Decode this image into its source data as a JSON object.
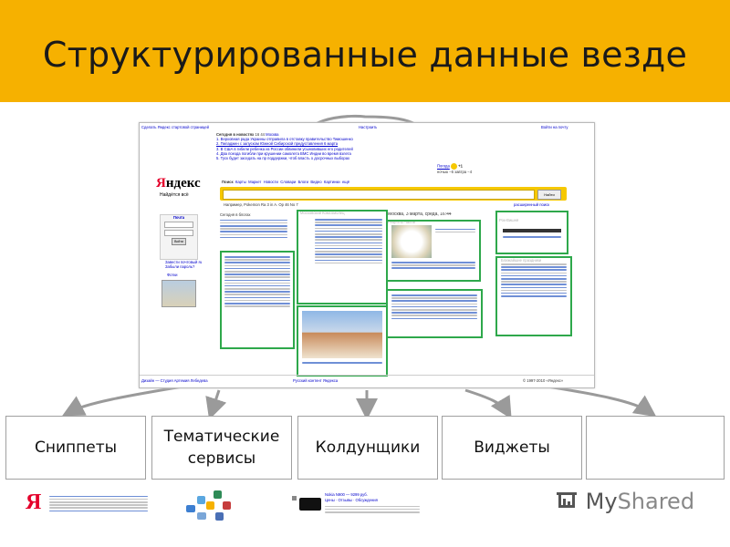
{
  "slide": {
    "title": "Структурированные данные везде",
    "accent_color": "#f6b100"
  },
  "screenshot": {
    "top_links": "Сделать Яндекс стартовой страницей",
    "top_right": "Настроить",
    "top_right2": "Войти на почту",
    "news_header": "Сегодня в новостях",
    "news_time": "16 44",
    "news_city": "Москва",
    "news": [
      "1. Верховная рада Украины отправила в отставку правительство Тимошенко",
      "2. Пиладжен с запуском Южной Сибирской предуставления 6 марта",
      "3. В США в гибели ребенка из России обвинили усыновивших его родителей",
      "4. Два поезда погибли при крушении самолета ВМС Индии во время взлета",
      "5. Туск будет заседать на пр поддержки, чтоб власть о досрочных выборах"
    ],
    "weather": "Погода",
    "weather_temp": "+1",
    "weather_sub": "ночью −6  завтра −4",
    "logo_y": "Я",
    "logo_rest": "ндекс",
    "logo_sub": "Найдётся всё",
    "tabs": [
      "Поиск",
      "Карты",
      "Маркет",
      "Новости",
      "Словари",
      "Блоги",
      "Видео",
      "Картинки",
      "ещё"
    ],
    "search_example": "Например, Pokemon Ra 3 in A. Ор 46 No 7",
    "search_button": "Найти",
    "search_advanced": "расширенный поиск",
    "mail_label": "Почта",
    "mail_button": "Войти",
    "mail_links": [
      "Завести почтовый ящик",
      "Забыли пароль?"
    ],
    "photos": "Фотки",
    "col_blogs": "Сегодня в блогах",
    "col_komsomol": "Московский Комсомолец",
    "col_date": "Москва, 3 марта, среда, 16:44",
    "col_recipes": "Рецепты Чаппи",
    "col_radio": "Рок-Вишня",
    "col_holidays": "Ближайшие праздники",
    "bottom_left": "Дизайн — Студия Артемия Лебедева",
    "bottom_mid": "Русский контент Яндекса",
    "copyright": "© 1997-2010 «Яндекс»"
  },
  "categories": [
    {
      "label": "Сниппеты"
    },
    {
      "label": "Тематические сервисы"
    },
    {
      "label": "Колдунщики"
    },
    {
      "label": "Виджеты"
    },
    {
      "label": ""
    }
  ],
  "footer": {
    "brand_my": "My",
    "brand_shared": "Shared",
    "yandex_logo_letter": "Я",
    "thumb_title": "Nokia N900 — 9299 руб.",
    "thumb_sub": "Цены · Отзывы · Обсуждения"
  }
}
